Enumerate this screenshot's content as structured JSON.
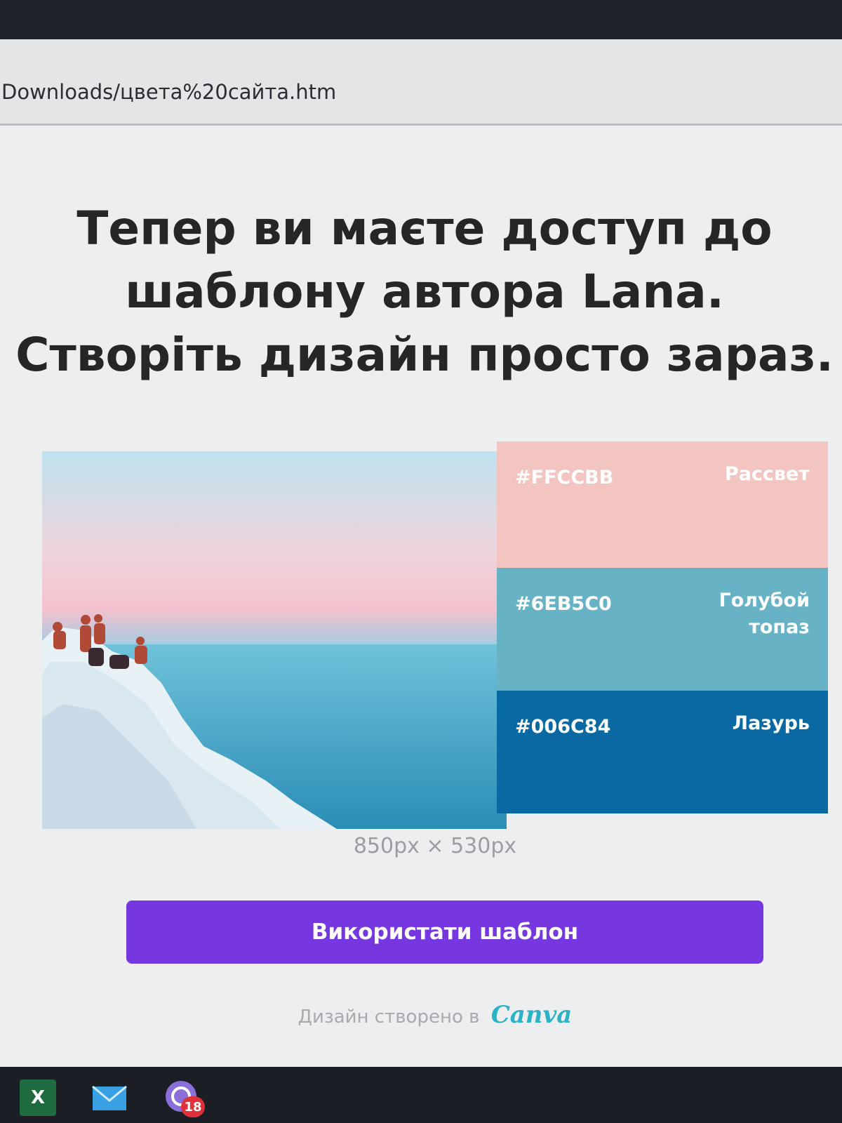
{
  "browser": {
    "url": "Downloads/цвета%20сайта.htm"
  },
  "page": {
    "headline_lines": [
      "Тепер ви маєте доступ до",
      "шаблону автора Lana.",
      "Створіть дизайн просто зараз."
    ],
    "swatches": [
      {
        "hex": "#FFCCBB",
        "name": "Рассвет",
        "color": "#FFCCBB"
      },
      {
        "hex": "#6EB5C0",
        "name": "Голубой топаз",
        "color": "#6EB5C0"
      },
      {
        "hex": "#006C84",
        "name": "Лазурь",
        "color": "#006C84"
      }
    ],
    "dimensions": "850px × 530px",
    "use_template_label": "Використати шаблон",
    "credit_prefix": "Дизайн створено в",
    "credit_brand": "Canva",
    "accent_color": "#7636E0"
  },
  "taskbar": {
    "items": [
      {
        "icon": "excel-icon",
        "label": "X"
      },
      {
        "icon": "mail-icon"
      },
      {
        "icon": "viber-icon",
        "badge": "18"
      }
    ]
  }
}
